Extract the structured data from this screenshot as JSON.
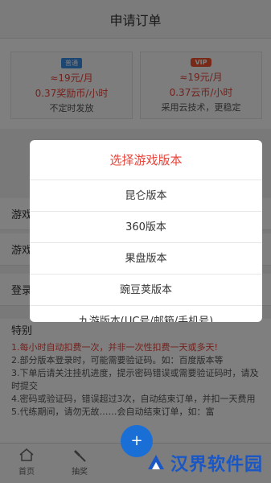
{
  "header": {
    "title": "申请订单"
  },
  "plans": [
    {
      "badge": "普通",
      "price": "≈19元/月",
      "rate": "0.37奖励币/小时",
      "desc": "不定时发放"
    },
    {
      "badge": "VIP",
      "price": "≈19元/月",
      "rate": "0.37云币/小时",
      "desc": "采用云技术，更稳定"
    }
  ],
  "rows": [
    {
      "label": "游戏"
    },
    {
      "label": "游戏"
    },
    {
      "label": "登录"
    }
  ],
  "notes": {
    "title": "特别",
    "items": [
      "1.每小时自动扣费一次，并非一次性扣费一天或多天!",
      "2.部分版本登录时，可能需要验证码。如：百度版本等",
      "3.下单后请关注挂机进度，提示密码错误或需要验证码时，请及时提交",
      "4.密码或验证码，错误超过3次，自动结束订单，并扣一天费用",
      "5.代练期间，请勿无故……会自动结束订单，如：富"
    ]
  },
  "modal": {
    "title": "选择游戏版本",
    "options": [
      "昆仑版本",
      "360版本",
      "果盘版本",
      "豌豆荚版本",
      "九游版本(UC号/邮箱/手机号)"
    ]
  },
  "nav": {
    "home": "首页",
    "draw": "抽奖"
  },
  "watermark": {
    "text": "汉界软件园"
  },
  "colors": {
    "accent": "#e8443a",
    "brand": "#1b57c4"
  }
}
